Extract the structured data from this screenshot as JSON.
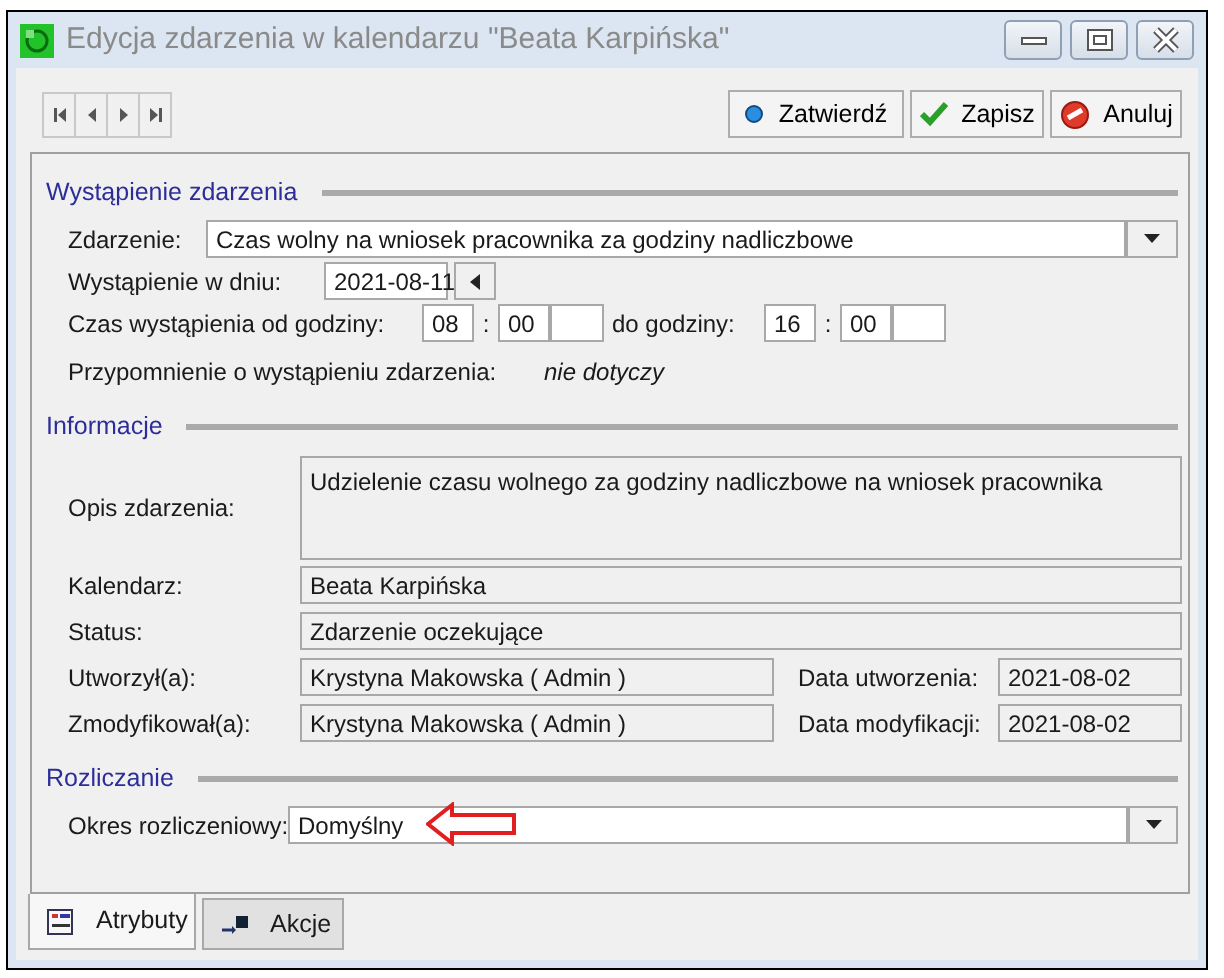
{
  "window": {
    "title": "Edycja zdarzenia w kalendarzu \"Beata Karpińska\""
  },
  "actions": [
    {
      "label": "Zatwierdź",
      "kind": "confirm"
    },
    {
      "label": "Zapisz",
      "kind": "save"
    },
    {
      "label": "Anuluj",
      "kind": "cancel"
    }
  ],
  "occurrence": {
    "heading": "Wystąpienie zdarzenia",
    "event": {
      "label": "Zdarzenie:",
      "value": "Czas wolny na wniosek pracownika za godziny nadliczbowe"
    },
    "date": {
      "label": "Wystąpienie w dniu:",
      "value": "2021-08-11"
    },
    "time": {
      "label": "Czas wystąpienia od godziny:",
      "from_hour": "08",
      "from_separator": ":",
      "from_minute": "00",
      "to_label": "do godziny:",
      "to_hour": "16",
      "to_separator": ":",
      "to_minute": "00"
    },
    "reminder": {
      "label": "Przypomnienie o wystąpieniu zdarzenia:",
      "value": "nie dotyczy"
    }
  },
  "information": {
    "heading": "Informacje",
    "description": {
      "label": "Opis zdarzenia:",
      "value": "Udzielenie czasu wolnego za godziny nadliczbowe na wniosek pracownika"
    },
    "calendar": {
      "label": "Kalendarz:",
      "value": "Beata Karpińska"
    },
    "status": {
      "label": "Status:",
      "value": "Zdarzenie oczekujące"
    },
    "created_by": {
      "label": "Utworzył(a):",
      "value": "Krystyna Makowska ( Admin )"
    },
    "created_date": {
      "label": "Data utworzenia:",
      "value": "2021-08-02"
    },
    "modified_by": {
      "label": "Zmodyfikował(a):",
      "value": "Krystyna Makowska ( Admin )"
    },
    "modified_date": {
      "label": "Data modyfikacji:",
      "value": "2021-08-02"
    }
  },
  "settlement": {
    "heading": "Rozliczanie",
    "period": {
      "label": "Okres rozliczeniowy:",
      "value": "Domyślny"
    }
  },
  "tabs": [
    {
      "label": "Atrybuty",
      "selected": true,
      "kind": "attributes"
    },
    {
      "label": "Akcje",
      "selected": false,
      "kind": "actions"
    }
  ]
}
